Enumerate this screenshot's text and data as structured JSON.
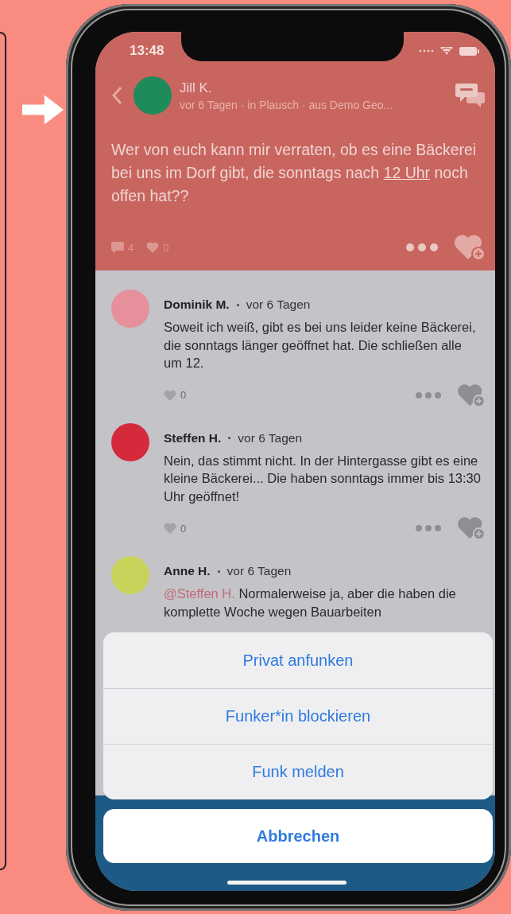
{
  "status_bar": {
    "time": "13:48"
  },
  "post": {
    "author": "Jill K.",
    "meta": "vor 6 Tagen · in Plausch · aus Demo Geo...",
    "text_before": "Wer von euch kann mir verraten, ob es eine Bäckerei bei uns im Dorf gibt, die sonntags nach ",
    "link": "12 Uhr",
    "text_after": " noch offen hat??",
    "comment_count": "4",
    "like_count": "0"
  },
  "comments": [
    {
      "author": "Dominik M.",
      "time": "vor 6 Tagen",
      "color": "#e5909a",
      "text": "Soweit ich weiß, gibt es bei uns leider keine Bäckerei, die sonntags länger geöffnet hat. Die schließen alle um 12.",
      "like_count": "0"
    },
    {
      "author": "Steffen H.",
      "time": "vor 6 Tagen",
      "color": "#d42a3c",
      "text": "Nein, das stimmt nicht. In der Hintergasse gibt es eine kleine Bäckerei... Die haben sonntags immer bis 13:30 Uhr geöffnet!",
      "like_count": "0"
    },
    {
      "author": "Anne H.",
      "time": "vor 6 Tagen",
      "color": "#c8d35c",
      "mention": "@Steffen H.",
      "text": "Normalerweise ja, aber die haben die komplette Woche wegen Bauarbeiten"
    }
  ],
  "action_sheet": {
    "actions": [
      "Privat anfunken",
      "Funker*in blockieren",
      "Funk melden"
    ],
    "cancel": "Abbrechen"
  }
}
